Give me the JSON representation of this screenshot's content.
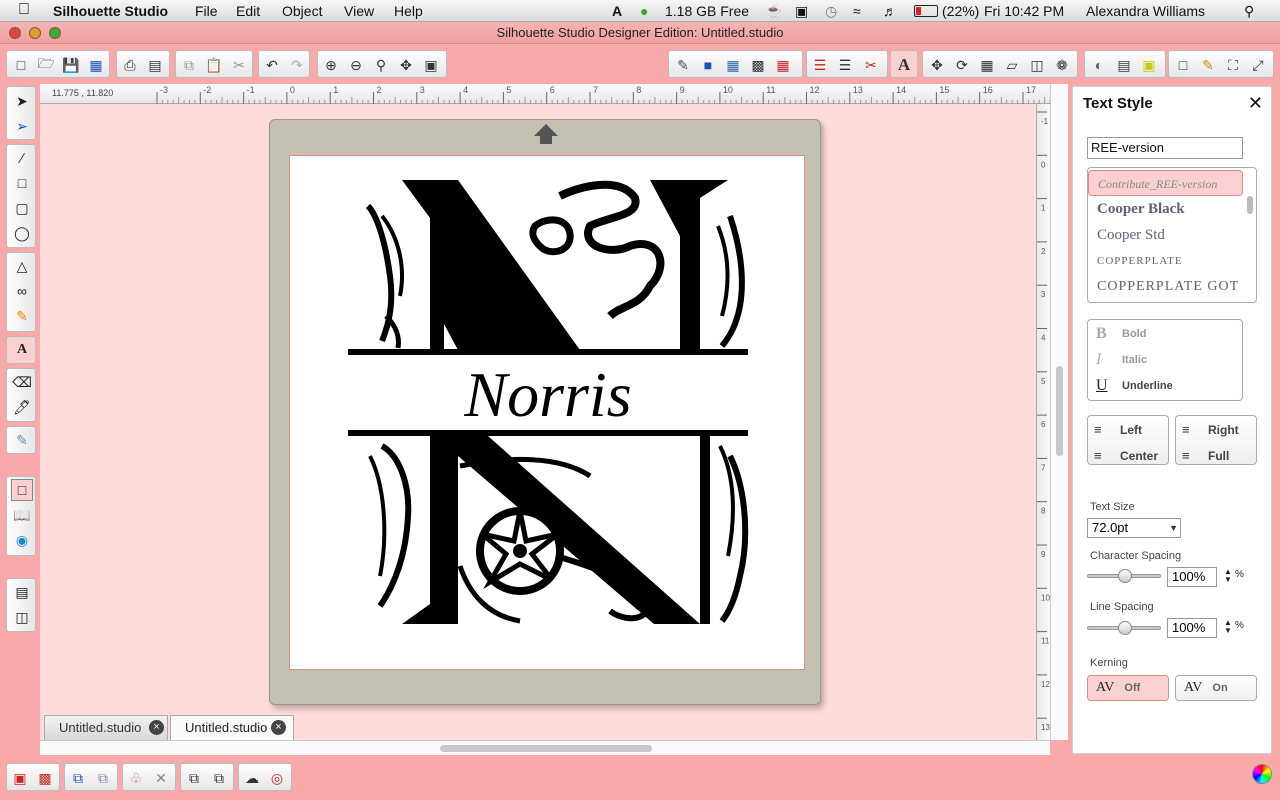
{
  "menubar": {
    "app_name": "Silhouette Studio",
    "menus": [
      "File",
      "Edit",
      "Object",
      "View",
      "Help"
    ],
    "memory": "1.18 GB Free",
    "battery": "(22%)",
    "clock": "Fri 10:42 PM",
    "user": "Alexandra Williams"
  },
  "window": {
    "title": "Silhouette Studio Designer Edition: Untitled.studio"
  },
  "ruler": {
    "coordinates": "11.775 , 11.820",
    "h_labels": [
      "-3",
      "-2",
      "-1",
      "0",
      "1",
      "2",
      "3",
      "4",
      "5",
      "6",
      "7",
      "8",
      "9",
      "10",
      "11",
      "12",
      "13",
      "14",
      "15",
      "16",
      "17"
    ],
    "v_labels": [
      "-1",
      "0",
      "1",
      "2",
      "3",
      "4",
      "5",
      "6",
      "7",
      "8",
      "9",
      "10",
      "11",
      "12",
      "13"
    ]
  },
  "design": {
    "monogram_letter": "N",
    "name_text": "Norris"
  },
  "tabs": [
    {
      "label": "Untitled.studio",
      "active": false
    },
    {
      "label": "Untitled.studio",
      "active": true
    }
  ],
  "panel": {
    "title": "Text Style",
    "font_input": "REE-version",
    "fonts": [
      "Contribute_REE-version",
      "Cooper Black",
      "Cooper Std",
      "COPPERPLATE",
      "COPPERPLATE GOT"
    ],
    "styles": {
      "bold_glyph": "B",
      "bold": "Bold",
      "italic_glyph": "I",
      "italic": "Italic",
      "underline_glyph": "U",
      "underline": "Underline"
    },
    "align": {
      "left": "Left",
      "center": "Center",
      "right": "Right",
      "full": "Full"
    },
    "text_size_label": "Text Size",
    "text_size": "72.0pt",
    "char_spacing_label": "Character Spacing",
    "char_spacing": "100%",
    "line_spacing_label": "Line Spacing",
    "line_spacing": "100%",
    "percent_sign": "%",
    "kerning_label": "Kerning",
    "kerning_glyph": "AV",
    "kerning_off": "Off",
    "kerning_on": "On"
  },
  "colors": {
    "window_bg": "#f9a9a9",
    "workarea": "#ffdcdc",
    "mat": "#c3c1b0",
    "selected_font": "#fbd0d0"
  }
}
